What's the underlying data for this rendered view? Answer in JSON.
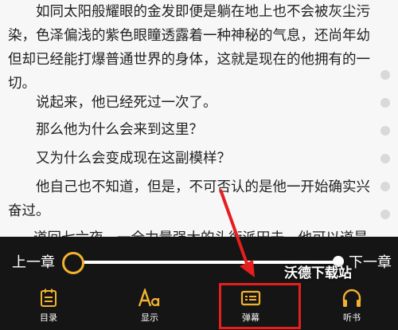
{
  "reader": {
    "paragraphs": [
      "　　如同太阳般耀眼的金发即便是躺在地上也不会被灰尘污染，色泽偏浅的紫色眼瞳透露着一种神秘的气息，还尚年幼但却已经能打爆普通世界的身体，这就是现在的他拥有的一切。",
      "　　说起来，他已经死过一次了。",
      "　　那么他为什么会来到这里？",
      "　　又为什么会变成现在这副模样？",
      "　　他自己也不知道，但是，不可否认的是他一开始确实兴奋过。"
    ],
    "partial_line": "道回七六夜，一全力量强大的头衔派田去，他可以道是"
  },
  "chapter_bar": {
    "prev_label": "上一章",
    "next_label": "下一章",
    "progress": 0.0
  },
  "bottom_nav": {
    "items": [
      {
        "label": "目录",
        "icon": "catalog-icon"
      },
      {
        "label": "显示",
        "icon": "font-display-icon"
      },
      {
        "label": "弹幕",
        "icon": "danmaku-icon"
      },
      {
        "label": "听书",
        "icon": "headphones-icon"
      }
    ]
  },
  "watermark": "沃德下载站",
  "colors": {
    "accent": "#f2b230",
    "panel": "#151515",
    "annotation": "#e51e1e"
  }
}
